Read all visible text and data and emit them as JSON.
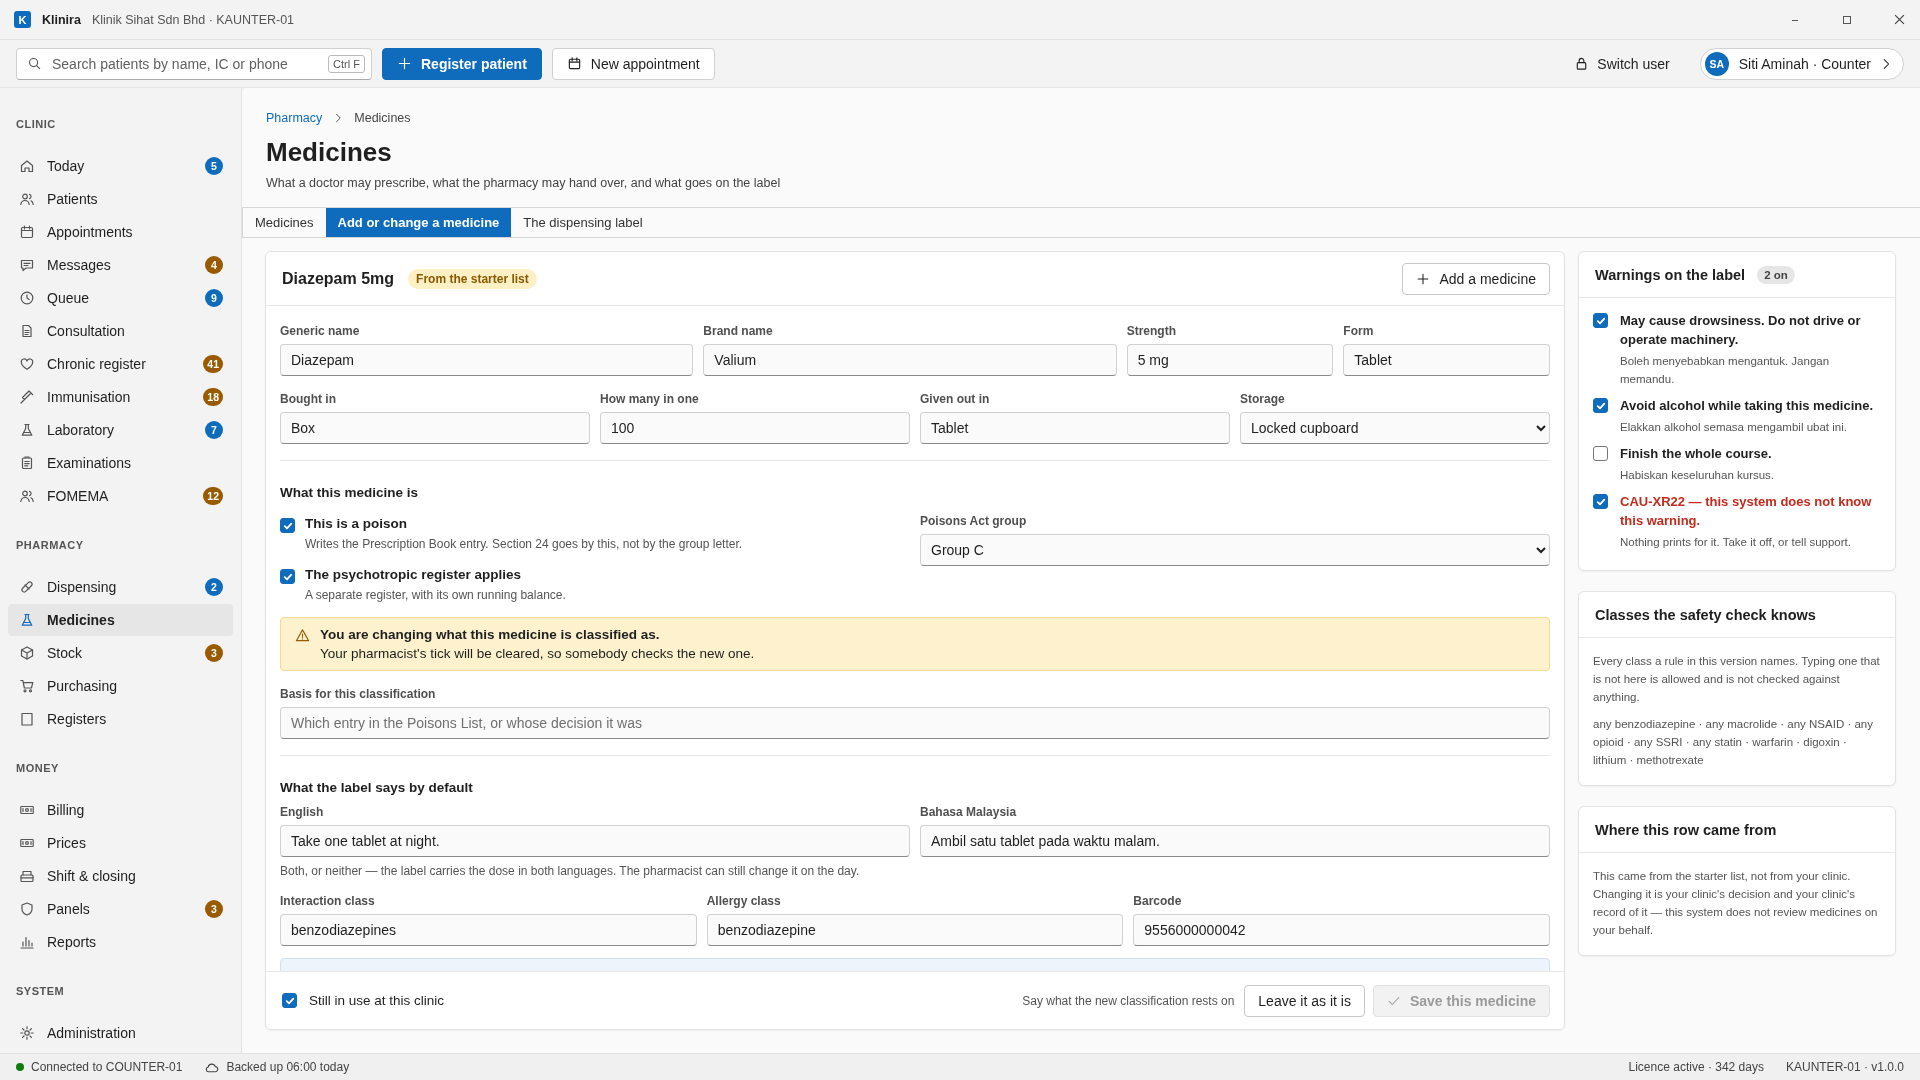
{
  "window": {
    "logo_letter": "K",
    "app_name": "Klinira",
    "subtitle": "Klinik Sihat Sdn Bhd · KAUNTER-01"
  },
  "toolbar": {
    "search": {
      "placeholder": "Search patients by name, IC or phone",
      "shortcut": "Ctrl F"
    },
    "register_button": "Register patient",
    "appointment_button": "New appointment",
    "switch_user": "Switch user",
    "user": {
      "initials": "SA",
      "label": "Siti Aminah · Counter"
    }
  },
  "sidebar": {
    "sections": [
      {
        "title": "CLINIC",
        "items": [
          {
            "label": "Today",
            "selected": false,
            "badge": {
              "text": "5",
              "color": "#0f6cbd"
            }
          },
          {
            "label": "Patients",
            "selected": false
          },
          {
            "label": "Appointments",
            "selected": false
          },
          {
            "label": "Messages",
            "selected": false,
            "badge": {
              "text": "4",
              "color": "#9a5a00"
            }
          },
          {
            "label": "Queue",
            "selected": false,
            "badge": {
              "text": "9",
              "color": "#0f6cbd"
            }
          },
          {
            "label": "Consultation",
            "selected": false
          },
          {
            "label": "Chronic register",
            "selected": false,
            "badge": {
              "text": "41",
              "color": "#9a5a00"
            }
          },
          {
            "label": "Immunisation",
            "selected": false,
            "badge": {
              "text": "18",
              "color": "#9a5a00"
            }
          },
          {
            "label": "Laboratory",
            "selected": false,
            "badge": {
              "text": "7",
              "color": "#0f6cbd"
            }
          },
          {
            "label": "Examinations",
            "selected": false
          },
          {
            "label": "FOMEMA",
            "selected": false,
            "badge": {
              "text": "12",
              "color": "#9a5a00"
            }
          }
        ]
      },
      {
        "title": "PHARMACY",
        "items": [
          {
            "label": "Dispensing",
            "selected": false,
            "badge": {
              "text": "2",
              "color": "#0f6cbd"
            }
          },
          {
            "label": "Medicines",
            "selected": true
          },
          {
            "label": "Stock",
            "selected": false,
            "badge": {
              "text": "3",
              "color": "#9a5a00"
            }
          },
          {
            "label": "Purchasing",
            "selected": false
          },
          {
            "label": "Registers",
            "selected": false
          }
        ]
      },
      {
        "title": "MONEY",
        "items": [
          {
            "label": "Billing",
            "selected": false
          },
          {
            "label": "Prices",
            "selected": false
          },
          {
            "label": "Shift & closing",
            "selected": false
          },
          {
            "label": "Panels",
            "selected": false,
            "badge": {
              "text": "3",
              "color": "#9a5a00"
            }
          },
          {
            "label": "Reports",
            "selected": false
          }
        ]
      },
      {
        "title": "SYSTEM",
        "items": [
          {
            "label": "Administration",
            "selected": false
          }
        ]
      }
    ]
  },
  "page": {
    "breadcrumb": [
      "Pharmacy",
      "Medicines"
    ],
    "title": "Medicines",
    "subtitle": "What a doctor may prescribe, what the pharmacy may hand over, and what goes on the label"
  },
  "tabs": [
    {
      "label": "Medicines",
      "selected": false
    },
    {
      "label": "Add or change a medicine",
      "selected": true
    },
    {
      "label": "The dispensing label",
      "selected": false
    }
  ],
  "form": {
    "title": "Diazepam 5mg",
    "tag": "From the starter list",
    "add_button": "Add a medicine",
    "rows": [
      [
        {
          "label": "Generic name",
          "value": "Diazepam",
          "kind": "text"
        },
        {
          "label": "Brand name",
          "value": "Valium",
          "kind": "text"
        },
        {
          "label": "Strength",
          "value": "5 mg",
          "kind": "text"
        },
        {
          "label": "Form",
          "value": "Tablet",
          "kind": "text"
        }
      ],
      [
        {
          "label": "Bought in",
          "value": "Box",
          "kind": "text"
        },
        {
          "label": "How many in one",
          "value": "100",
          "kind": "text"
        },
        {
          "label": "Given out in",
          "value": "Tablet",
          "kind": "text"
        },
        {
          "label": "Storage",
          "value": "Locked cupboard",
          "kind": "select"
        }
      ]
    ],
    "classification": {
      "heading": "What this medicine is",
      "checks": [
        {
          "label": "This is a poison",
          "hint": "Writes the Prescription Book entry. Section 24 goes by this, not by the group letter.",
          "checked": true
        },
        {
          "label": "The psychotropic register applies",
          "hint": "A separate register, with its own running balance.",
          "checked": true
        }
      ],
      "group": {
        "label": "Poisons Act group",
        "value": "Group C"
      }
    },
    "alert": {
      "title": "You are changing what this medicine is classified as.",
      "body": "Your pharmacist's tick will be cleared, so somebody checks the new one."
    },
    "basis": {
      "label": "Basis for this classification",
      "placeholder": "Which entry in the Poisons List, or whose decision it was"
    },
    "label_defaults": {
      "heading": "What the label says by default",
      "fields": [
        {
          "label": "English",
          "value": "Take one tablet at night."
        },
        {
          "label": "Bahasa Malaysia",
          "value": "Ambil satu tablet pada waktu malam."
        }
      ],
      "hint": "Both, or neither — the label carries the dose in both languages. The pharmacist can still change it on the day."
    },
    "classes": [
      {
        "label": "Interaction class",
        "value": "benzodiazepines"
      },
      {
        "label": "Allergy class",
        "value": "benzodiazepine"
      },
      {
        "label": "Barcode",
        "value": "9556000000042"
      }
    ],
    "footer": {
      "in_use": {
        "label": "Still in use at this clinic",
        "checked": true
      },
      "note": "Say what the new classification rests on",
      "cancel_button": "Leave it as it is",
      "save_button": {
        "label": "Save this medicine",
        "disabled": true
      }
    }
  },
  "warnings": {
    "title": "Warnings on the label",
    "count": "2 on",
    "items": [
      {
        "text": "May cause drowsiness. Do not drive or operate machinery.",
        "translation": "Boleh menyebabkan mengantuk. Jangan memandu.",
        "checked": true,
        "kind": "known"
      },
      {
        "text": "Avoid alcohol while taking this medicine.",
        "translation": "Elakkan alkohol semasa mengambil ubat ini.",
        "checked": true,
        "kind": "known"
      },
      {
        "text": "Finish the whole course.",
        "translation": "Habiskan keseluruhan kursus.",
        "checked": false,
        "kind": "known"
      },
      {
        "text": "CAU-XR22 — this system does not know this warning.",
        "translation": "Nothing prints for it. Take it off, or tell support.",
        "checked": true,
        "kind": "unknown"
      }
    ]
  },
  "classes_panel": {
    "title": "Classes the safety check knows",
    "body": "Every class a rule in this version names. Typing one that is not here is allowed and is not checked against anything.",
    "classes": "any benzodiazepine · any macrolide · any NSAID · any opioid · any SSRI · any statin · warfarin · digoxin · lithium · methotrexate"
  },
  "origin_panel": {
    "title": "Where this row came from",
    "body": "This came from the starter list, not from your clinic. Changing it is your clinic's decision and your clinic's record of it — this system does not review medicines on your behalf."
  },
  "status_bar": {
    "connected": true,
    "connection": "Connected to COUNTER-01",
    "backup": "Backed up 06:00 today",
    "licence": "Licence active · 342 days",
    "version": "KAUNTER-01 · v1.0.0"
  }
}
